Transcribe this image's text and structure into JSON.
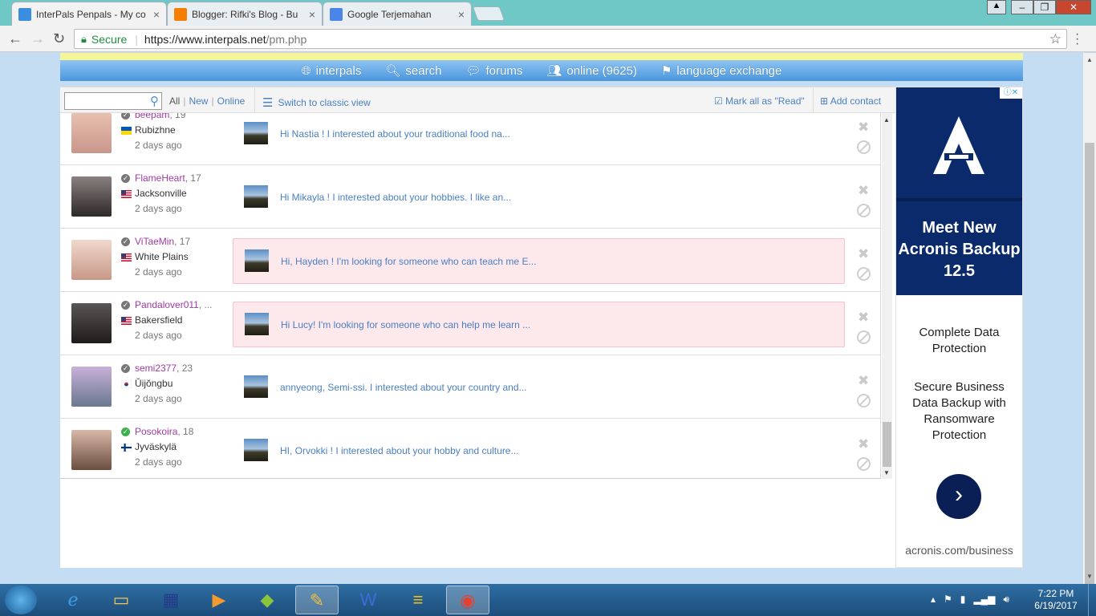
{
  "browser": {
    "tabs": [
      {
        "title": "InterPals Penpals - My co",
        "favicon_color": "#3b8de0",
        "active": true
      },
      {
        "title": "Blogger: Rifki's Blog - Bu",
        "favicon_color": "#f57d00",
        "active": false
      },
      {
        "title": "Google Terjemahan",
        "favicon_color": "#4a86e8",
        "active": false
      }
    ],
    "secure_label": "Secure",
    "url_host": "https://www.interpals.net",
    "url_path": "/pm.php"
  },
  "nav": {
    "items": [
      {
        "label": "interpals",
        "icon": "globe-icon"
      },
      {
        "label": "search",
        "icon": "magnifier-icon"
      },
      {
        "label": "forums",
        "icon": "speech-bubble-icon"
      },
      {
        "label": "online (9625)",
        "icon": "people-icon"
      },
      {
        "label": "language exchange",
        "icon": "flags-icon"
      }
    ]
  },
  "toolbar": {
    "search_placeholder": "",
    "filter_all": "All",
    "filter_new": "New",
    "filter_online": "Online",
    "classic_view": "Switch to classic view",
    "mark_read": "Mark all as \"Read\"",
    "add_contact": "Add contact"
  },
  "messages": [
    {
      "username": "beepam",
      "age": ", 19",
      "city": "Rubizhne",
      "flag": "ukraine",
      "when": "2 days ago",
      "preview": "Hi Nastia ! I interested about your traditional food na...",
      "unread": false,
      "online": false,
      "avatar_color": "#c7968a"
    },
    {
      "username": "FlameHeart",
      "age": ", 17",
      "city": "Jacksonville",
      "flag": "usa",
      "when": "2 days ago",
      "preview": "Hi Mikayla ! I interested about your hobbies. I like an...",
      "unread": false,
      "online": false,
      "avatar_color": "#4a4040"
    },
    {
      "username": "ViTaeMin",
      "age": ", 17",
      "city": "White Plains",
      "flag": "usa",
      "when": "2 days ago",
      "preview": "Hi, Hayden ! I'm looking for someone who can teach me E...",
      "unread": true,
      "online": false,
      "avatar_color": "#d6a89a"
    },
    {
      "username": "Pandalover011",
      "age": ", ...",
      "city": "Bakersfield",
      "flag": "usa",
      "when": "2 days ago",
      "preview": "Hi Lucy! I'm looking for someone who can help me learn ...",
      "unread": true,
      "online": false,
      "avatar_color": "#3d3838"
    },
    {
      "username": "semi2377",
      "age": ", 23",
      "city": "Ŭijŏngbu",
      "flag": "korea",
      "when": "2 days ago",
      "preview": "annyeong, Semi-ssi. I interested about your country and...",
      "unread": false,
      "online": false,
      "avatar_color": "#9fa8b8"
    },
    {
      "username": "Posokoira",
      "age": ", 18",
      "city": "Jyväskylä",
      "flag": "finland",
      "when": "2 days ago",
      "preview": "HI, Orvokki ! I interested about your hobby and culture...",
      "unread": false,
      "online": true,
      "avatar_color": "#b49080"
    }
  ],
  "ad": {
    "info_label": "ⓘ✕",
    "headline": "Meet New Acronis Backup 12.5",
    "body1": "Complete Data Protection",
    "body2": "Secure Business Data Backup with Ransomware Protection",
    "url": "acronis.com/business"
  },
  "taskbar": {
    "time": "7:22 PM",
    "date": "6/19/2017"
  },
  "colors": {
    "accent_blue": "#4a7fc2",
    "username_purple": "#a03aa3",
    "unread_bg": "#fde8ec",
    "ad_navy": "#0a2a6b"
  }
}
